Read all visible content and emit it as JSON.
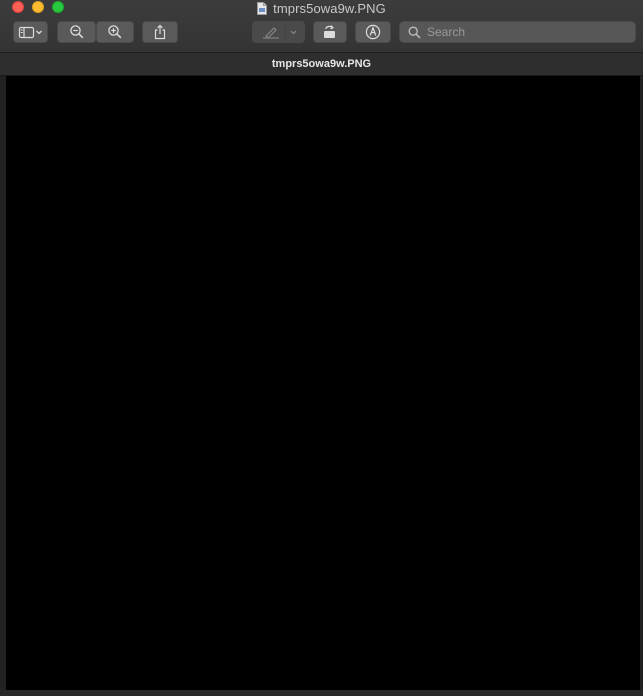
{
  "window": {
    "title": "tmprs5owa9w.PNG",
    "doc_header": "tmprs5owa9w.PNG"
  },
  "toolbar": {
    "buttons": [
      {
        "name": "sidebar-toggle",
        "icon": "sidebar-icon"
      },
      {
        "name": "zoom-out",
        "icon": "zoom-out-icon"
      },
      {
        "name": "zoom-in",
        "icon": "zoom-in-icon"
      },
      {
        "name": "share",
        "icon": "share-icon"
      },
      {
        "name": "highlight",
        "icon": "pen-icon"
      },
      {
        "name": "rotate",
        "icon": "rotate-icon"
      },
      {
        "name": "markup",
        "icon": "markup-icon"
      }
    ],
    "search": {
      "placeholder": "Search",
      "value": ""
    }
  },
  "colors": {
    "toolbar_bg": "#3a3a3a",
    "content_bg": "#000000",
    "close": "#fe5f57",
    "minimize": "#febc2e",
    "zoom": "#28c840"
  }
}
